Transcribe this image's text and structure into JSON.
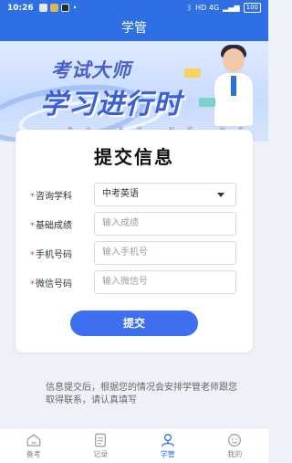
{
  "status_bar": {
    "time": "10:26",
    "network": "HD 4G",
    "battery": "100",
    "dot": "•"
  },
  "header": {
    "title": "学管"
  },
  "banner": {
    "subtitle": "考试大师",
    "headline": "学习进行时",
    "tagline": "专 业 · 高 效 · 权 威 · 服 务"
  },
  "form": {
    "title": "提交信息",
    "fields": [
      {
        "label": "咨询学科",
        "value": "中考英语",
        "placeholder": "",
        "type": "select"
      },
      {
        "label": "基础成绩",
        "value": "",
        "placeholder": "输入成绩",
        "type": "input"
      },
      {
        "label": "手机号码",
        "value": "",
        "placeholder": "输入手机号",
        "type": "input"
      },
      {
        "label": "微信号码",
        "value": "",
        "placeholder": "输入微信号",
        "type": "input"
      }
    ],
    "required_mark": "*",
    "submit_label": "提交"
  },
  "notice": "信息提交后，根据您的情况会安排学管老师跟您取得联系，请认真填写",
  "tabs": [
    {
      "label": "备考",
      "icon": "home-icon",
      "active": false
    },
    {
      "label": "记录",
      "icon": "document-icon",
      "active": false
    },
    {
      "label": "学管",
      "icon": "advisor-icon",
      "active": true
    },
    {
      "label": "我的",
      "icon": "profile-icon",
      "active": false
    }
  ],
  "colors": {
    "primary": "#2f6fe6",
    "button": "#3d6ff0",
    "required": "#e5484d"
  }
}
